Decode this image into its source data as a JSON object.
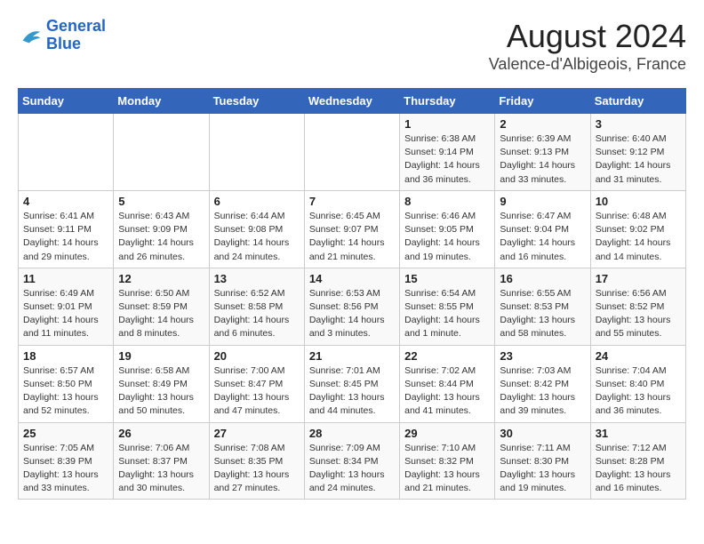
{
  "header": {
    "logo_line1": "General",
    "logo_line2": "Blue",
    "main_title": "August 2024",
    "subtitle": "Valence-d'Albigeois, France"
  },
  "days_of_week": [
    "Sunday",
    "Monday",
    "Tuesday",
    "Wednesday",
    "Thursday",
    "Friday",
    "Saturday"
  ],
  "weeks": [
    {
      "cells": [
        {
          "day": "",
          "info": ""
        },
        {
          "day": "",
          "info": ""
        },
        {
          "day": "",
          "info": ""
        },
        {
          "day": "",
          "info": ""
        },
        {
          "day": "1",
          "info": "Sunrise: 6:38 AM\nSunset: 9:14 PM\nDaylight: 14 hours\nand 36 minutes."
        },
        {
          "day": "2",
          "info": "Sunrise: 6:39 AM\nSunset: 9:13 PM\nDaylight: 14 hours\nand 33 minutes."
        },
        {
          "day": "3",
          "info": "Sunrise: 6:40 AM\nSunset: 9:12 PM\nDaylight: 14 hours\nand 31 minutes."
        }
      ]
    },
    {
      "cells": [
        {
          "day": "4",
          "info": "Sunrise: 6:41 AM\nSunset: 9:11 PM\nDaylight: 14 hours\nand 29 minutes."
        },
        {
          "day": "5",
          "info": "Sunrise: 6:43 AM\nSunset: 9:09 PM\nDaylight: 14 hours\nand 26 minutes."
        },
        {
          "day": "6",
          "info": "Sunrise: 6:44 AM\nSunset: 9:08 PM\nDaylight: 14 hours\nand 24 minutes."
        },
        {
          "day": "7",
          "info": "Sunrise: 6:45 AM\nSunset: 9:07 PM\nDaylight: 14 hours\nand 21 minutes."
        },
        {
          "day": "8",
          "info": "Sunrise: 6:46 AM\nSunset: 9:05 PM\nDaylight: 14 hours\nand 19 minutes."
        },
        {
          "day": "9",
          "info": "Sunrise: 6:47 AM\nSunset: 9:04 PM\nDaylight: 14 hours\nand 16 minutes."
        },
        {
          "day": "10",
          "info": "Sunrise: 6:48 AM\nSunset: 9:02 PM\nDaylight: 14 hours\nand 14 minutes."
        }
      ]
    },
    {
      "cells": [
        {
          "day": "11",
          "info": "Sunrise: 6:49 AM\nSunset: 9:01 PM\nDaylight: 14 hours\nand 11 minutes."
        },
        {
          "day": "12",
          "info": "Sunrise: 6:50 AM\nSunset: 8:59 PM\nDaylight: 14 hours\nand 8 minutes."
        },
        {
          "day": "13",
          "info": "Sunrise: 6:52 AM\nSunset: 8:58 PM\nDaylight: 14 hours\nand 6 minutes."
        },
        {
          "day": "14",
          "info": "Sunrise: 6:53 AM\nSunset: 8:56 PM\nDaylight: 14 hours\nand 3 minutes."
        },
        {
          "day": "15",
          "info": "Sunrise: 6:54 AM\nSunset: 8:55 PM\nDaylight: 14 hours\nand 1 minute."
        },
        {
          "day": "16",
          "info": "Sunrise: 6:55 AM\nSunset: 8:53 PM\nDaylight: 13 hours\nand 58 minutes."
        },
        {
          "day": "17",
          "info": "Sunrise: 6:56 AM\nSunset: 8:52 PM\nDaylight: 13 hours\nand 55 minutes."
        }
      ]
    },
    {
      "cells": [
        {
          "day": "18",
          "info": "Sunrise: 6:57 AM\nSunset: 8:50 PM\nDaylight: 13 hours\nand 52 minutes."
        },
        {
          "day": "19",
          "info": "Sunrise: 6:58 AM\nSunset: 8:49 PM\nDaylight: 13 hours\nand 50 minutes."
        },
        {
          "day": "20",
          "info": "Sunrise: 7:00 AM\nSunset: 8:47 PM\nDaylight: 13 hours\nand 47 minutes."
        },
        {
          "day": "21",
          "info": "Sunrise: 7:01 AM\nSunset: 8:45 PM\nDaylight: 13 hours\nand 44 minutes."
        },
        {
          "day": "22",
          "info": "Sunrise: 7:02 AM\nSunset: 8:44 PM\nDaylight: 13 hours\nand 41 minutes."
        },
        {
          "day": "23",
          "info": "Sunrise: 7:03 AM\nSunset: 8:42 PM\nDaylight: 13 hours\nand 39 minutes."
        },
        {
          "day": "24",
          "info": "Sunrise: 7:04 AM\nSunset: 8:40 PM\nDaylight: 13 hours\nand 36 minutes."
        }
      ]
    },
    {
      "cells": [
        {
          "day": "25",
          "info": "Sunrise: 7:05 AM\nSunset: 8:39 PM\nDaylight: 13 hours\nand 33 minutes."
        },
        {
          "day": "26",
          "info": "Sunrise: 7:06 AM\nSunset: 8:37 PM\nDaylight: 13 hours\nand 30 minutes."
        },
        {
          "day": "27",
          "info": "Sunrise: 7:08 AM\nSunset: 8:35 PM\nDaylight: 13 hours\nand 27 minutes."
        },
        {
          "day": "28",
          "info": "Sunrise: 7:09 AM\nSunset: 8:34 PM\nDaylight: 13 hours\nand 24 minutes."
        },
        {
          "day": "29",
          "info": "Sunrise: 7:10 AM\nSunset: 8:32 PM\nDaylight: 13 hours\nand 21 minutes."
        },
        {
          "day": "30",
          "info": "Sunrise: 7:11 AM\nSunset: 8:30 PM\nDaylight: 13 hours\nand 19 minutes."
        },
        {
          "day": "31",
          "info": "Sunrise: 7:12 AM\nSunset: 8:28 PM\nDaylight: 13 hours\nand 16 minutes."
        }
      ]
    }
  ]
}
